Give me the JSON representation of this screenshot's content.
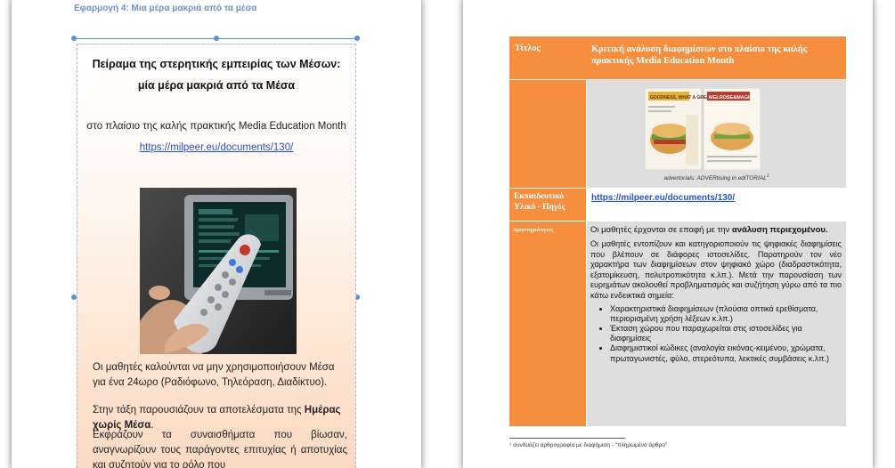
{
  "left_page": {
    "top_strip": "Εφαρμογή 4: Μια μέρα μακριά από τα μέσα",
    "title_line1": "Πείραμα της στερητικής εμπειρίας των Μέσων:",
    "title_line2": "μία μέρα μακριά από τα Μέσα",
    "subtitle": "στο πλαίσιο της καλής πρακτικής Media Education Month",
    "link": "https://milpeer.eu/documents/130/",
    "para1": "Οι μαθητές καλούνται να μην χρησιμοποιήσουν Μέσα για ένα 24ωρο (Ραδιόφωνο, Τηλεόραση, Διαδίκτυο).",
    "para2_prefix": "Στην τάξη παρουσιάζουν τα αποτελέσματα της ",
    "para2_bold": "Ημέρας χωρίς Μέσα",
    "para2_suffix": ".",
    "para3": "Εκφράζουν τα συναισθήματα που βίωσαν, αναγνωρίζουν τους παράγοντες επιτυχίας ή αποτυχίας και συζητούν για το ρόλο που"
  },
  "right_page": {
    "row1_label": "Τίτλος",
    "row1_value": "Κριτική ανάλυση διαφημίσεων στο πλαίσιο της καλής πρακτικής Media Education Month",
    "magazine_left_headline": "GOODNESS, WHAT A GREAT TREAT!",
    "magazine_right_headline": "MELROSE&MAGIC",
    "caption": "advertorials: ADVERtising in ediTORIAL",
    "caption_sup": "1",
    "row3_label": "Εκπαιδευτικό Υλικό - Πηγές",
    "row3_link": "https://milpeer.eu/documents/130/",
    "row4_label": "Δραστηριότητες",
    "intro_prefix": "Οι μαθητές έρχονται σε επαφή με την ",
    "intro_bold": "ανάλυση περιεχομένου.",
    "body": "Οι μαθητές εντοπίζουν και κατηγοριοποιούν τις ψηφιακές διαφημίσεις που βλέπουν σε διάφορες ιστοσελίδες. Παρατηρούν τον νέο χαρακτήρα των διαφημίσεων στον ψηφιακό χώρο (διαδραστικότητα, εξατομίκευση, πολυτροπικότητα κ.λπ.). Μετά την παρουσίαση των ευρημάτων ακολουθεί προβληματισμός και συζήτηση γύρω από τα πιο κάτω ενδεικτικά σημεία:",
    "bullets": [
      "Χαρακτηριστικά διαφημίσεων (πλούσια οπτικά ερεθίσματα, περιορισμένη χρήση λέξεων κ.λπ.)",
      "Έκταση χώρου που παραχωρείται στις ιστοσελίδες για διαφημίσεις",
      "Διαφημιστικοί κώδικες (αναλογία εικόνας-κειμένου, χρώματα, πρωταγωνιστές, φύλο, στερεότυπα, λεκτικές συμβάσεις κ.λπ.)"
    ],
    "footnote": "¹ συνδυάζει αρθρογραφία με διαφήμιση - \"πληρωμένο άρθρο\""
  },
  "colors": {
    "orange": "#f58e3f",
    "gray_cell": "#dedede",
    "link_blue": "#2a52c9"
  }
}
